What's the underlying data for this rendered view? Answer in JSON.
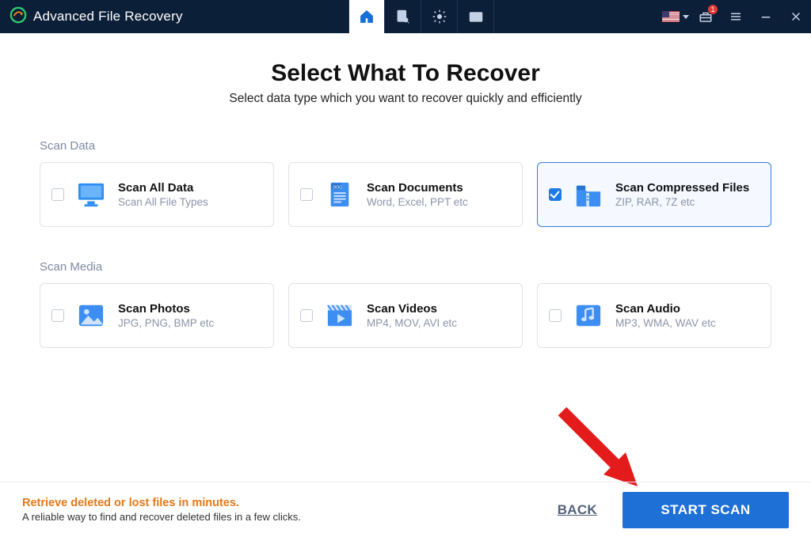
{
  "app": {
    "title": "Advanced File Recovery"
  },
  "titlebar": {
    "tabs": [
      "home",
      "file-search",
      "settings",
      "mail"
    ],
    "badge_count": "1"
  },
  "heading": {
    "title": "Select What To Recover",
    "subtitle": "Select data type which you want to recover quickly and efficiently"
  },
  "sections": {
    "data": {
      "label": "Scan Data",
      "cards": [
        {
          "title": "Scan All Data",
          "sub": "Scan All File Types",
          "icon": "monitor",
          "checked": false
        },
        {
          "title": "Scan Documents",
          "sub": "Word, Excel, PPT etc",
          "icon": "document",
          "checked": false
        },
        {
          "title": "Scan Compressed Files",
          "sub": "ZIP, RAR, 7Z etc",
          "icon": "zip",
          "checked": true
        }
      ]
    },
    "media": {
      "label": "Scan Media",
      "cards": [
        {
          "title": "Scan Photos",
          "sub": "JPG, PNG, BMP etc",
          "icon": "photo",
          "checked": false
        },
        {
          "title": "Scan Videos",
          "sub": "MP4, MOV, AVI etc",
          "icon": "video",
          "checked": false
        },
        {
          "title": "Scan Audio",
          "sub": "MP3, WMA, WAV etc",
          "icon": "audio",
          "checked": false
        }
      ]
    }
  },
  "footer": {
    "promo_title": "Retrieve deleted or lost files in minutes.",
    "promo_sub": "A reliable way to find and recover deleted files in a few clicks.",
    "back_label": "BACK",
    "start_label": "START SCAN"
  },
  "colors": {
    "accent": "#1e6fd6",
    "header": "#0c1f38",
    "promo": "#e67817"
  }
}
